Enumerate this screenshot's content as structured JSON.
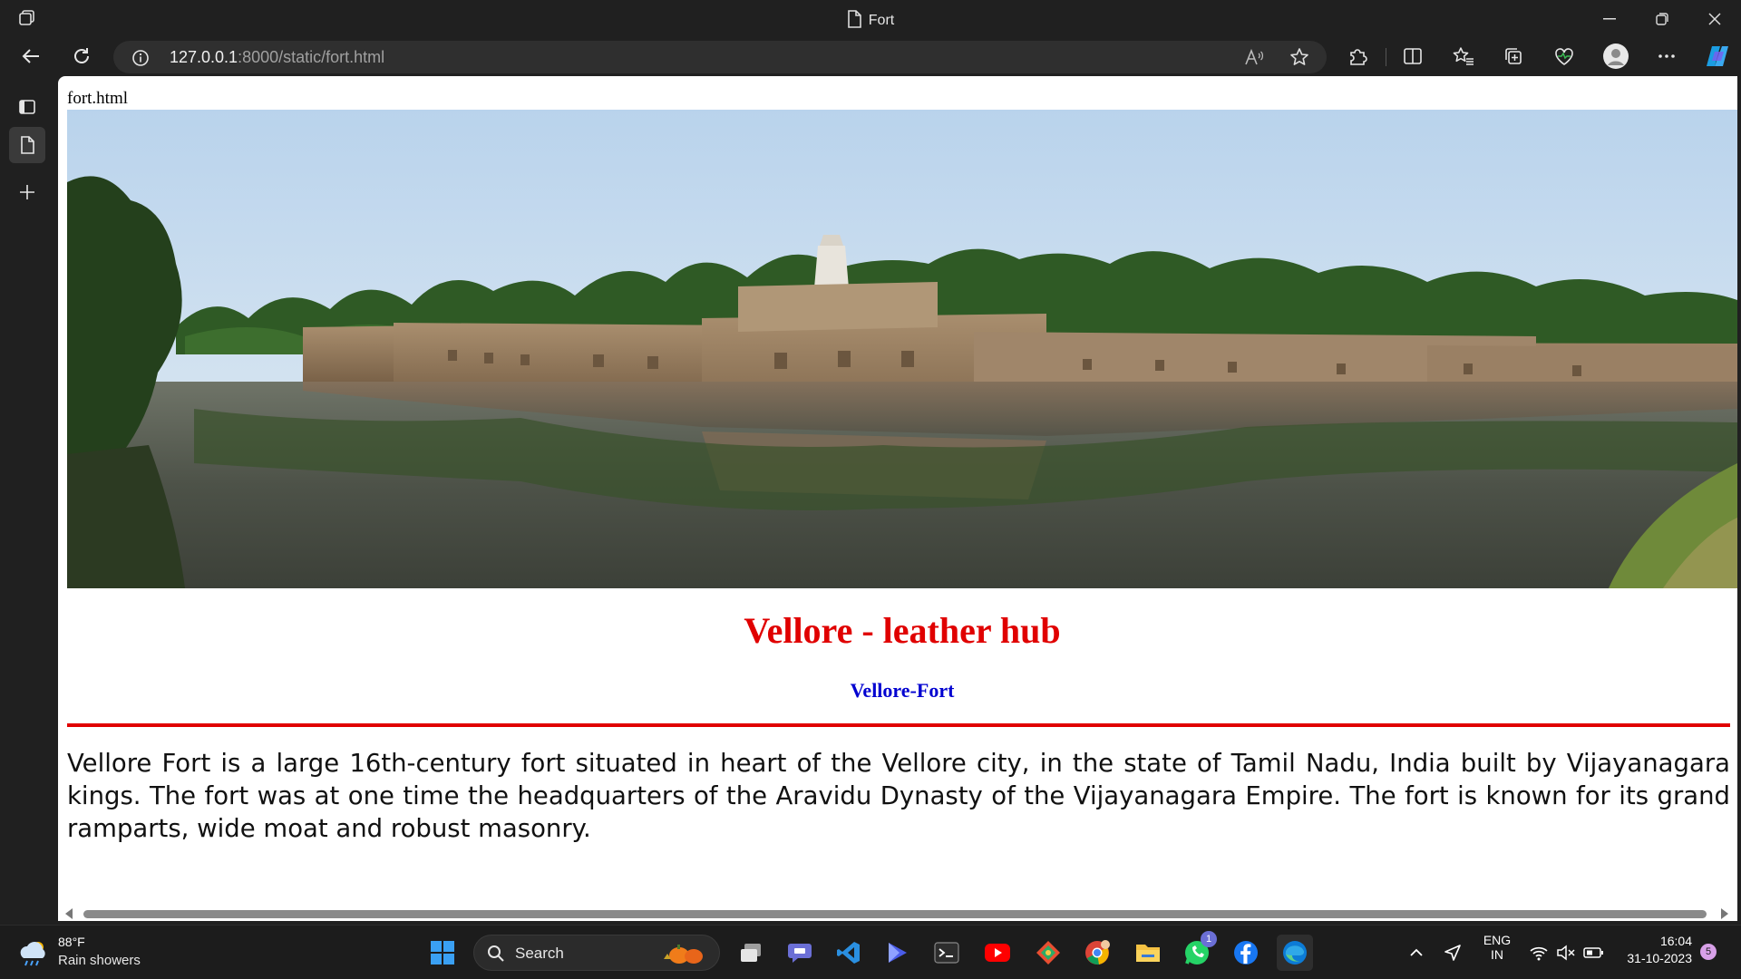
{
  "window": {
    "title": "Fort"
  },
  "toolbar": {
    "url_host": "127.0.0.1",
    "url_rest": ":8000/static/fort.html"
  },
  "page": {
    "image_alt": "fort.html",
    "heading": "Vellore - leather hub",
    "subheading": "Vellore-Fort",
    "paragraph": "Vellore Fort is a large 16th-century fort situated in heart of the Vellore city, in the state of Tamil Nadu, India built by Vijayanagara kings. The fort was at one time the headquarters of the Aravidu Dynasty of the Vijayanagara Empire. The fort is known for its grand ramparts, wide moat and robust masonry."
  },
  "taskbar": {
    "weather_temp": "88°F",
    "weather_cond": "Rain showers",
    "search_label": "Search",
    "whatsapp_badge": "1",
    "lang_line1": "ENG",
    "lang_line2": "IN",
    "time": "16:04",
    "date": "31-10-2023",
    "notification_count": "5"
  },
  "colors": {
    "heading": "#e00000",
    "subheading": "#0000d0",
    "rule": "#e00000"
  }
}
